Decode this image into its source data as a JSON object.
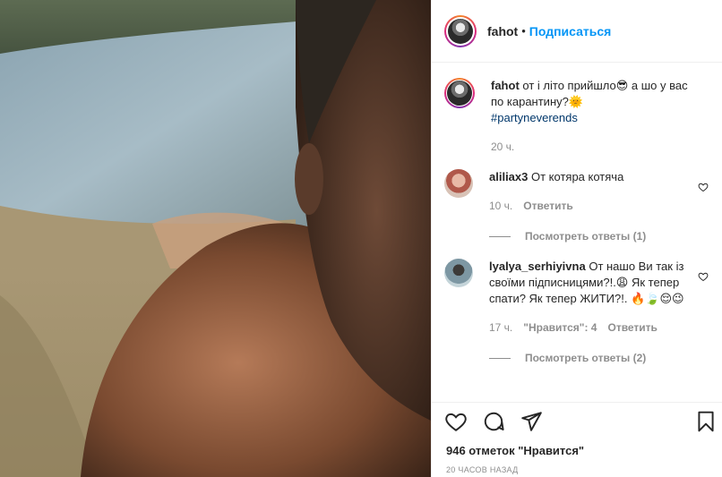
{
  "header": {
    "username": "fahot",
    "separator": "•",
    "follow_label": "Подписаться"
  },
  "caption": {
    "username": "fahot",
    "text": "от і літо прийшло😎 а шо у вас по карантину?🌞",
    "hashtag": "#partyneverends",
    "time": "20 ч."
  },
  "comments": [
    {
      "username": "aliliax3",
      "text": "От котяра котяча",
      "time": "10 ч.",
      "reply_label": "Ответить",
      "view_replies": "Посмотреть ответы (1)"
    },
    {
      "username": "lyalya_serhiyivna",
      "text": "От нашо Ви так із своїми підписницями?!.😩 Як тепер спати? Як тепер ЖИТИ?!. 🔥🍃😌😉",
      "time": "17 ч.",
      "likes_label": "\"Нравится\": 4",
      "reply_label": "Ответить",
      "view_replies": "Посмотреть ответы (2)"
    }
  ],
  "footer": {
    "likes": "946 отметок \"Нравится\"",
    "timestamp": "20 ЧАСОВ НАЗАД"
  },
  "colors": {
    "link": "#0095f6",
    "muted": "#8e8e8e",
    "text": "#262626",
    "hashtag": "#00376b"
  },
  "icons": [
    "heart-icon",
    "comment-icon",
    "share-icon",
    "bookmark-icon"
  ]
}
